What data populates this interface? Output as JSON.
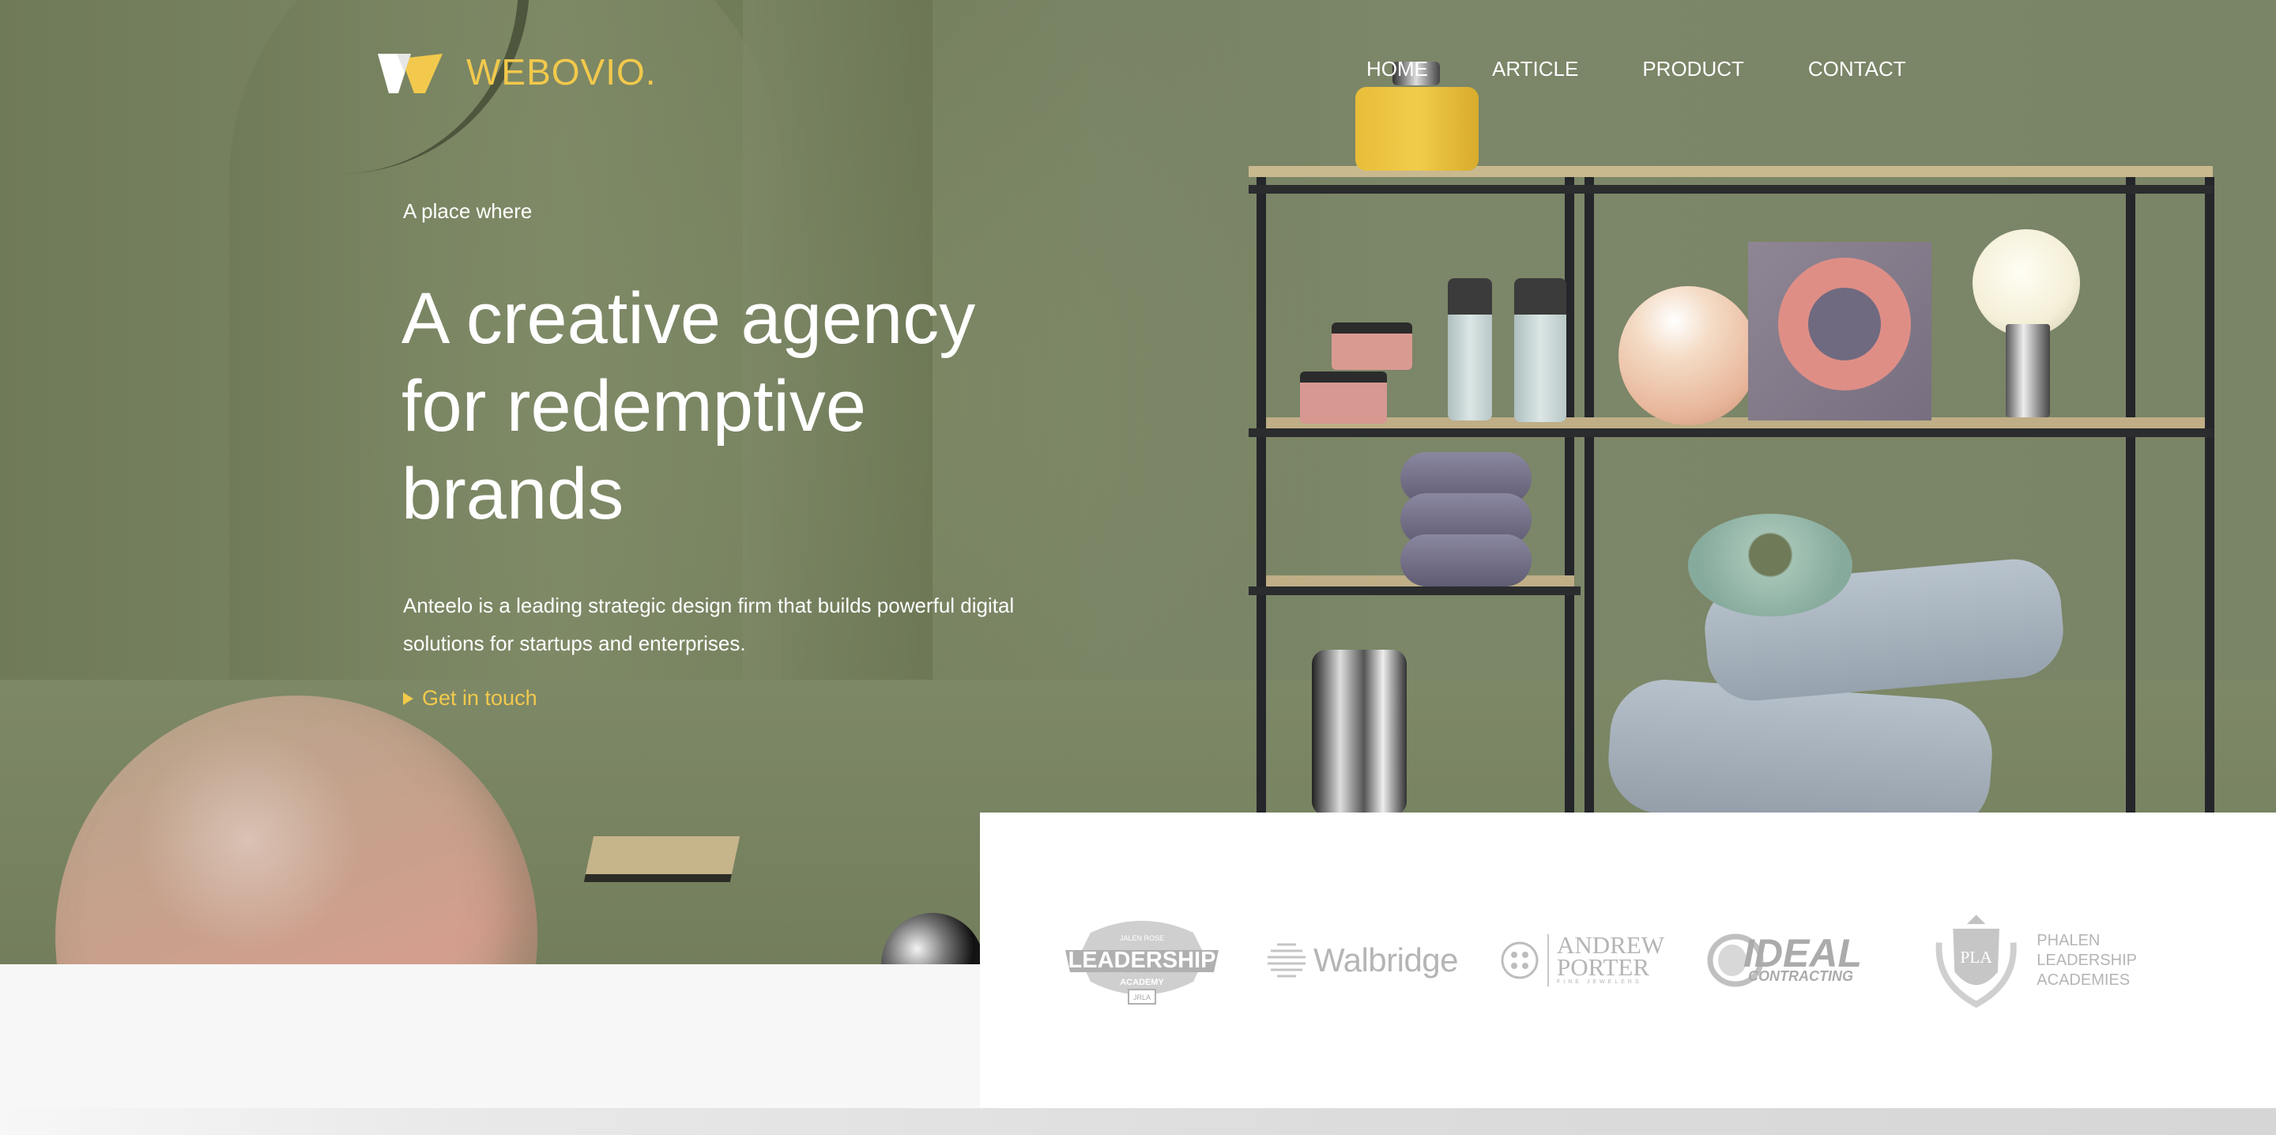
{
  "brand": {
    "name": "WEBOVIO.",
    "accent_color": "#F2C94C"
  },
  "nav": {
    "items": [
      {
        "label": "HOME"
      },
      {
        "label": "ARTICLE"
      },
      {
        "label": "PRODUCT"
      },
      {
        "label": "CONTACT"
      }
    ]
  },
  "hero": {
    "eyebrow": "A place where",
    "headline_line1": "A creative agency",
    "headline_line2": "for redemptive",
    "headline_line3": "brands",
    "description_line1": "Anteelo is a leading strategic design firm that builds powerful digital",
    "description_line2": "solutions for startups and enterprises.",
    "cta_label": "Get in touch"
  },
  "client_logos": {
    "leadership": {
      "top": "JALEN ROSE",
      "main": "LEADERSHIP",
      "sub": "ACADEMY",
      "badge": "JRLA"
    },
    "walbridge": {
      "name": "Walbridge"
    },
    "andrew_porter": {
      "line1": "ANDREW",
      "line2": "PORTER",
      "tagline": "FINE JEWELERS"
    },
    "ideal": {
      "main": "IDEAL",
      "sub": "CONTRACTING"
    },
    "phalen": {
      "monogram": "PLA",
      "line1": "PHALEN",
      "line2": "LEADERSHIP",
      "line3": "ACADEMIES"
    }
  }
}
